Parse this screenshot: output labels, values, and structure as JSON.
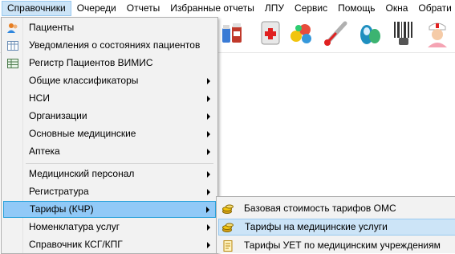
{
  "menubar": {
    "items": [
      "Справочники",
      "Очереди",
      "Отчеты",
      "Избранные отчеты",
      "ЛПУ",
      "Сервис",
      "Помощь",
      "Окна",
      "Обрати"
    ]
  },
  "toolbar": {
    "icons": [
      "medicine-bottles-icon",
      "medical-kit-icon",
      "pills-icon",
      "thermometer-icon",
      "capsules-icon",
      "barcode-scanner-icon",
      "nurse-icon"
    ]
  },
  "dropdown": {
    "items": [
      {
        "label": "Пациенты",
        "icon": "patients-icon"
      },
      {
        "label": "Уведомления о состояниях пациентов",
        "icon": "table-icon"
      },
      {
        "label": "Регистр Пациентов ВИМИС",
        "icon": "grid-icon"
      },
      {
        "label": "Общие классификаторы"
      },
      {
        "label": "НСИ"
      },
      {
        "label": "Организации"
      },
      {
        "label": "Основные медицинские"
      },
      {
        "label": "Аптека"
      },
      {
        "label": "Медицинский персонал"
      },
      {
        "label": "Регистратура"
      },
      {
        "label": "Тарифы (КЧР)"
      },
      {
        "label": "Номенклатура услуг"
      },
      {
        "label": "Справочник КСГ/КПГ"
      }
    ]
  },
  "submenu": {
    "items": [
      {
        "label": "Базовая стоимость тарифов ОМС",
        "icon": "coins-icon"
      },
      {
        "label": "Тарифы на медицинские услуги",
        "icon": "coins-icon"
      },
      {
        "label": "Тарифы УЕТ по медицинским учреждениям",
        "icon": "document-icon"
      }
    ]
  },
  "colors": {
    "menu_bg": "#f2f2f2",
    "highlight": "#91c9f7",
    "highlight_border": "#26a0da",
    "hover": "#cce4f7"
  }
}
